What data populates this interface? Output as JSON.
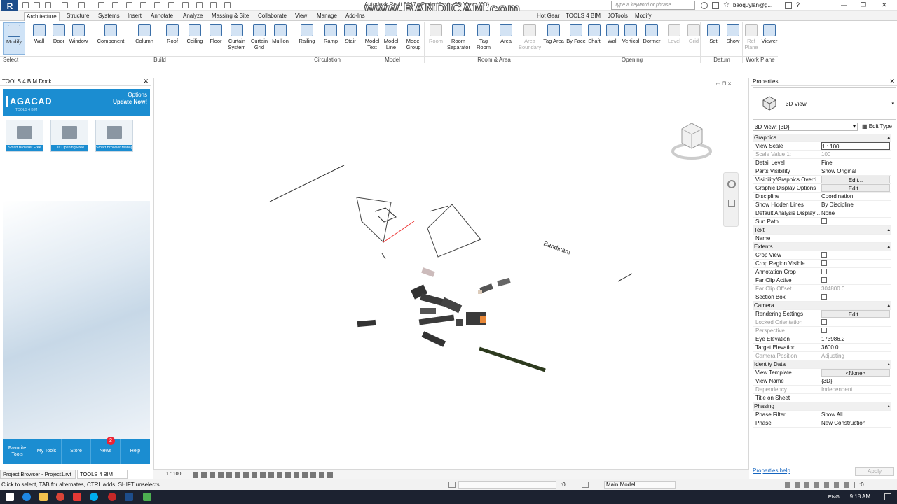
{
  "titlebar": {
    "app_title": "Autodesk Revit 2017 -   Project1.rvt - 3D View: {3D}",
    "watermark": "www.BANDICAM.com",
    "search_placeholder": "Type a keyword or phrase",
    "user": "baoquylan@g...",
    "logo_letter": "R"
  },
  "tabs": [
    "Architecture",
    "Structure",
    "Systems",
    "Insert",
    "Annotate",
    "Analyze",
    "Massing & Site",
    "Collaborate",
    "View",
    "Manage",
    "Add-Ins",
    "Hot Gear",
    "TOOLS 4 BIM",
    "JOTools",
    "Modify"
  ],
  "ribbon": {
    "buttons": [
      {
        "label": "Modify",
        "state": "selected"
      },
      {
        "label": "Wall"
      },
      {
        "label": "Door"
      },
      {
        "label": "Window"
      },
      {
        "label": "Component"
      },
      {
        "label": "Column"
      },
      {
        "label": "Roof"
      },
      {
        "label": "Ceiling"
      },
      {
        "label": "Floor"
      },
      {
        "label": "Curtain System"
      },
      {
        "label": "Curtain Grid"
      },
      {
        "label": "Mullion"
      },
      {
        "label": "Railing"
      },
      {
        "label": "Ramp"
      },
      {
        "label": "Stair"
      },
      {
        "label": "Model Text"
      },
      {
        "label": "Model Line"
      },
      {
        "label": "Model Group"
      },
      {
        "label": "Room",
        "state": "disabled"
      },
      {
        "label": "Room Separator"
      },
      {
        "label": "Tag Room"
      },
      {
        "label": "Area"
      },
      {
        "label": "Area Boundary",
        "state": "disabled"
      },
      {
        "label": "Tag Area"
      },
      {
        "label": "By Face"
      },
      {
        "label": "Shaft"
      },
      {
        "label": "Wall"
      },
      {
        "label": "Vertical"
      },
      {
        "label": "Dormer"
      },
      {
        "label": "Level",
        "state": "disabled"
      },
      {
        "label": "Grid",
        "state": "disabled"
      },
      {
        "label": "Set"
      },
      {
        "label": "Show"
      },
      {
        "label": "Ref Plane",
        "state": "disabled"
      },
      {
        "label": "Viewer"
      }
    ],
    "panels": [
      "Select",
      "Build",
      "Circulation",
      "Model",
      "Room & Area",
      "Opening",
      "Datum",
      "Work Plane"
    ]
  },
  "dock": {
    "title": "TOOLS 4 BIM Dock",
    "brand": "AGACAD",
    "brand_sub": "TOOLS 4 BIM",
    "options": "Options",
    "update": "Update Now!",
    "tools": [
      "Smart Browser Free",
      "Cut Opening Free",
      "Smart Browser Manage"
    ],
    "nav": [
      "Favorite Tools",
      "My Tools",
      "Store",
      "News",
      "Help"
    ],
    "news_badge": "2"
  },
  "viewbar": {
    "scale": "1 : 100"
  },
  "bottom_tabs": [
    "Project Browser - Project1.rvt",
    "TOOLS 4 BIM Dock"
  ],
  "properties": {
    "title": "Properties",
    "type_name": "3D View",
    "view_selector": "3D View: {3D}",
    "edit_type": "Edit Type",
    "rows": [
      {
        "k": "Graphics",
        "section": true
      },
      {
        "k": "View Scale",
        "v": "1 : 100",
        "box": true
      },
      {
        "k": "Scale Value    1:",
        "v": "100",
        "grey": true
      },
      {
        "k": "Detail Level",
        "v": "Fine"
      },
      {
        "k": "Parts Visibility",
        "v": "Show Original"
      },
      {
        "k": "Visibility/Graphics Overri...",
        "v": "Edit...",
        "btn": true
      },
      {
        "k": "Graphic Display Options",
        "v": "Edit...",
        "btn": true
      },
      {
        "k": "Discipline",
        "v": "Coordination"
      },
      {
        "k": "Show Hidden Lines",
        "v": "By Discipline"
      },
      {
        "k": "Default Analysis Display ...",
        "v": "None"
      },
      {
        "k": "Sun Path",
        "check": true
      },
      {
        "k": "Text",
        "section": true
      },
      {
        "k": "Name",
        "v": ""
      },
      {
        "k": "Extents",
        "section": true
      },
      {
        "k": "Crop View",
        "check": true
      },
      {
        "k": "Crop Region Visible",
        "check": true
      },
      {
        "k": "Annotation Crop",
        "check": true
      },
      {
        "k": "Far Clip Active",
        "check": true
      },
      {
        "k": "Far Clip Offset",
        "v": "304800.0",
        "grey": true
      },
      {
        "k": "Section Box",
        "check": true
      },
      {
        "k": "Camera",
        "section": true
      },
      {
        "k": "Rendering Settings",
        "v": "Edit...",
        "btn": true
      },
      {
        "k": "Locked Orientation",
        "check": true,
        "grey": true
      },
      {
        "k": "Perspective",
        "check": true,
        "grey": true
      },
      {
        "k": "Eye Elevation",
        "v": "173986.2"
      },
      {
        "k": "Target Elevation",
        "v": "3600.0"
      },
      {
        "k": "Camera Position",
        "v": "Adjusting",
        "grey": true
      },
      {
        "k": "Identity Data",
        "section": true
      },
      {
        "k": "View Template",
        "v": "<None>",
        "btn": true
      },
      {
        "k": "View Name",
        "v": "{3D}"
      },
      {
        "k": "Dependency",
        "v": "Independent",
        "grey": true
      },
      {
        "k": "Title on Sheet",
        "v": ""
      },
      {
        "k": "Phasing",
        "section": true
      },
      {
        "k": "Phase Filter",
        "v": "Show All"
      },
      {
        "k": "Phase",
        "v": "New Construction"
      }
    ],
    "help": "Properties help",
    "apply": "Apply"
  },
  "status": {
    "hint": "Click to select, TAB for alternates, CTRL adds, SHIFT unselects.",
    "zero1": ":0",
    "model": "Main Model",
    "zero2": ":0"
  },
  "taskbar": {
    "lang": "ENG",
    "time": "9:18 AM"
  },
  "colors": {
    "accent": "#1b8dd1",
    "revit_blue": "#1d4d8b"
  }
}
